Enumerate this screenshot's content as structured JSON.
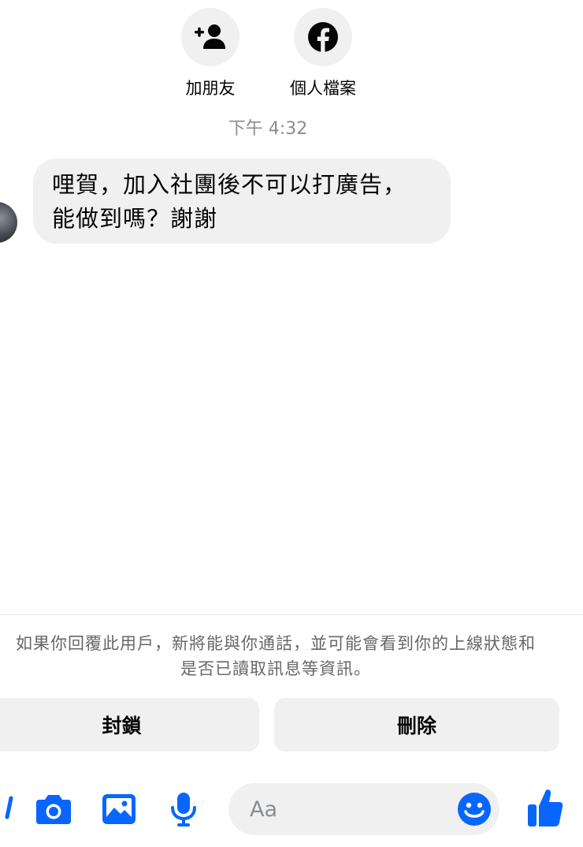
{
  "top_actions": {
    "add_friend_label": "加朋友",
    "profile_label": "個人檔案"
  },
  "conversation": {
    "timestamp": "下午 4:32",
    "message_lines": [
      "哩賀，加入社團後不可以打廣告，",
      "能做到嗎？謝謝"
    ]
  },
  "request_bar": {
    "notice_lines": [
      "如果你回覆此用戶，新將能與你通話，並可能會看到你的上線狀態和",
      "是否已讀取訊息等資訊。"
    ],
    "block_label": "封鎖",
    "delete_label": "刪除"
  },
  "composer": {
    "placeholder": "Aa",
    "icons": [
      "more-icon",
      "camera-icon",
      "image-icon",
      "microphone-icon",
      "emoji-icon",
      "like-icon"
    ]
  },
  "colors": {
    "accent": "#0866ff",
    "bubble_bg": "#f0f0f0",
    "secondary_text": "#8a8d91"
  }
}
